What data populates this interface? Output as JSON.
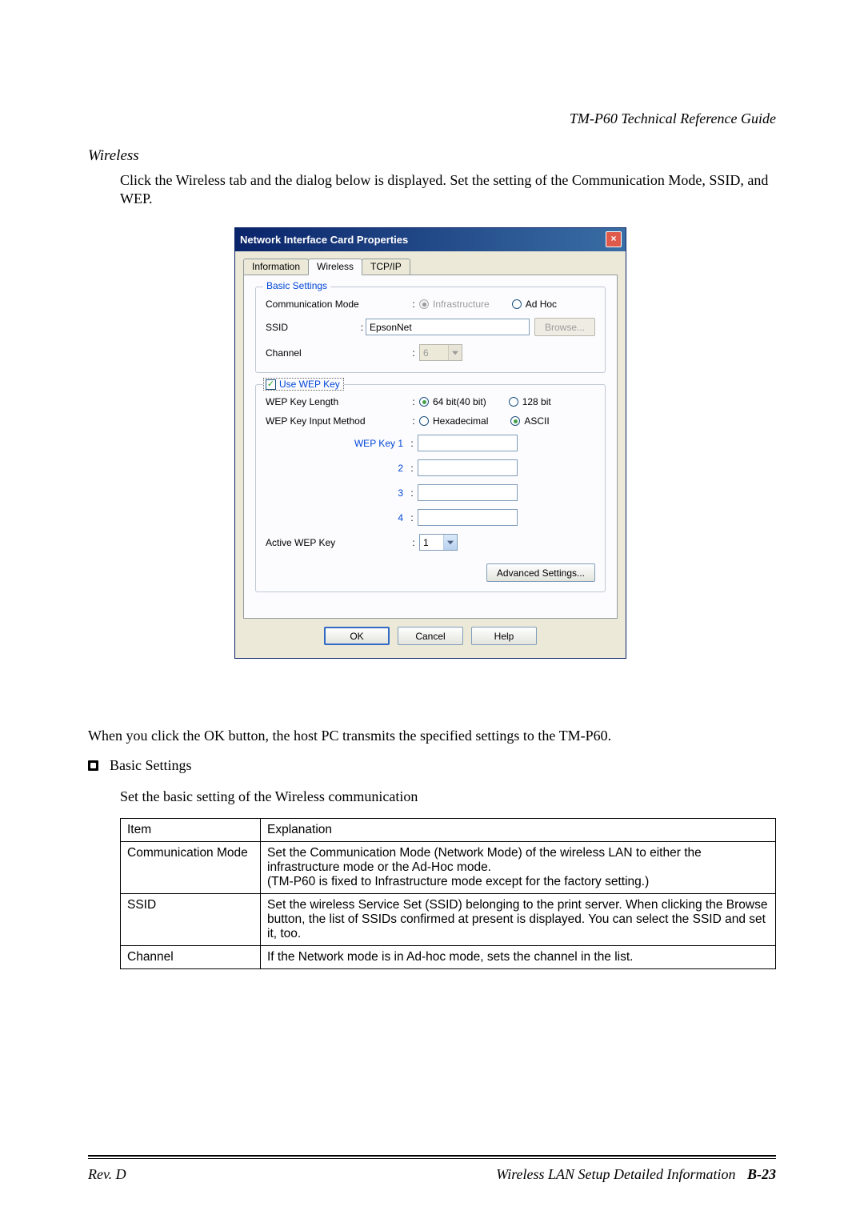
{
  "header": {
    "doc_title": "TM-P60 Technical Reference Guide"
  },
  "section": {
    "heading": "Wireless",
    "intro": "Click the Wireless tab and the dialog below is displayed.  Set the setting of the Communication Mode, SSID, and WEP."
  },
  "dialog": {
    "title": "Network Interface Card Properties",
    "close": "×",
    "tabs": {
      "information": "Information",
      "wireless": "Wireless",
      "tcpip": "TCP/IP"
    },
    "basic": {
      "legend": "Basic Settings",
      "comm_mode_label": "Communication Mode",
      "infra": "Infrastructure",
      "adhoc": "Ad Hoc",
      "ssid_label": "SSID",
      "ssid_value": "EpsonNet",
      "browse": "Browse...",
      "channel_label": "Channel",
      "channel_value": "6"
    },
    "wep": {
      "legend": "Use WEP Key",
      "len_label": "WEP Key Length",
      "b64": "64 bit(40 bit)",
      "b128": "128 bit",
      "input_label": "WEP Key Input Method",
      "hex": "Hexadecimal",
      "ascii": "ASCII",
      "k1": "WEP Key 1",
      "k2": "2",
      "k3": "3",
      "k4": "4",
      "active_label": "Active WEP Key",
      "active_value": "1",
      "advanced": "Advanced Settings..."
    },
    "buttons": {
      "ok": "OK",
      "cancel": "Cancel",
      "help": "Help"
    }
  },
  "after": {
    "p1": "When you click the OK button, the host PC transmits the specified settings to the TM-P60.",
    "bullet": "Basic Settings",
    "p2": "Set the basic setting of the Wireless communication"
  },
  "table": {
    "h1": "Item",
    "h2": "Explanation",
    "rows": [
      {
        "c1": "Communication Mode",
        "c2": "Set the Communication Mode (Network Mode) of the wireless LAN to either the infrastructure mode or the Ad-Hoc mode.\n(TM-P60 is fixed to Infrastructure mode except for the factory setting.)"
      },
      {
        "c1": "SSID",
        "c2": "Set the wireless Service Set (SSID) belonging to the print server. When clicking the Browse button, the list of SSIDs confirmed at present is displayed. You can select the SSID and set it, too."
      },
      {
        "c1": "Channel",
        "c2": "If the Network mode is in Ad-hoc mode, sets the channel in the list."
      }
    ]
  },
  "footer": {
    "rev": "Rev. D",
    "section": "Wireless LAN Setup Detailed Information",
    "page": "B-23"
  }
}
